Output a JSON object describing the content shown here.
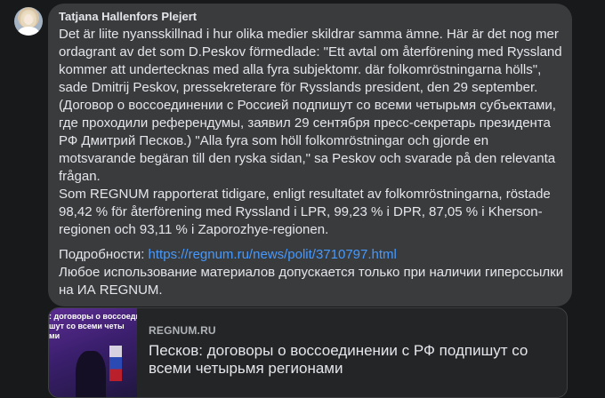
{
  "comment": {
    "author": "Tatjana Hallenfors Plejert",
    "paragraphs": [
      "Det är liite nyansskillnad i hur olika medier skildrar samma ämne. Här är det nog mer ordagrant av det som D.Peskov förmedlade: \"Ett avtal om återförening med Ryssland kommer att undertecknas med alla fyra subjektomr. där folkomröstningarna hölls\", sade Dmitrij Peskov, pressekreterare för Rysslands president, den 29 september. (Договор о воссоединении с Россией подпишут со всеми четырьмя субъектами, где проходили референдумы, заявил 29 сентября пресс-секретарь президента РФ Дмитрий Песков.) \"Alla fyra som höll folkomröstningar och gjorde en motsvarande begäran till den ryska sidan,\" sa Peskov och svarade på den relevanta frågan.",
      "Som REGNUM rapporterat tidigare, enligt resultatet av folkomröstningarna, röstade 98,42 % för återförening med Ryssland i LPR, 99,23 % i DPR, 87,05 % i Kherson-regionen och 93,11 % i Zaporozhye-regionen."
    ],
    "details_label": "Подробности:",
    "details_link": "https://regnum.ru/news/polit/3710797.html",
    "footer": "Любое использование материалов допускается только при наличии гиперссылки на ИА REGNUM."
  },
  "link_preview": {
    "thumb_text_lines": [
      ": договоры о воссоеди",
      "шут со всеми четы",
      "ми"
    ],
    "domain": "REGNUM.RU",
    "title": "Песков: договоры о воссоединении с РФ подпишут со всеми четырьмя регионами"
  },
  "colors": {
    "background": "#18191a",
    "bubble": "#3a3b3c",
    "link": "#4599ff",
    "text": "#e4e6eb",
    "muted": "#b0b3b8"
  }
}
